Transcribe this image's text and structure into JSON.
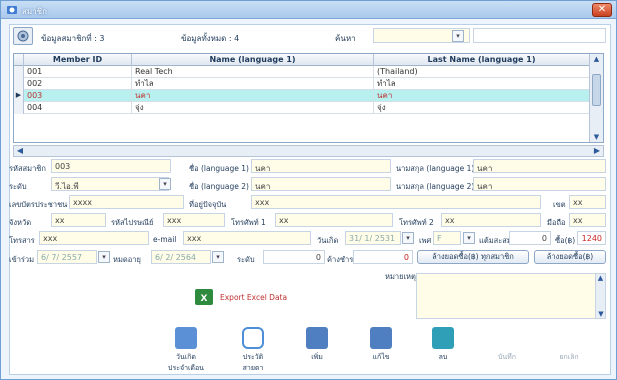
{
  "window": {
    "title": "สมาชิก",
    "close_label": "✕"
  },
  "summary": {
    "members_label": "ข้อมูลสมาชิกที่ : 3",
    "total_label": "ข้อมูลทั้งหมด : 4",
    "search_label": "ค้นหา",
    "search_value": ""
  },
  "grid": {
    "columns": [
      "Member ID",
      "Name (language 1)",
      "Last Name (language 1)"
    ],
    "rows": [
      {
        "id": "001",
        "name": "Real Tech",
        "last": "(Thailand)"
      },
      {
        "id": "002",
        "name": "ทำไล",
        "last": "ทำไล"
      },
      {
        "id": "003",
        "name": "นคา",
        "last": "นคา"
      },
      {
        "id": "004",
        "name": "จุ่ง",
        "last": "จุ่ง"
      }
    ],
    "selected_index": 2
  },
  "form": {
    "member_code_label": "รหัสสมาชิก",
    "member_code": "003",
    "name1_label": "ชื่อ (language 1)",
    "name1": "นคา",
    "lastname1_label": "นามสกุล (language 1)",
    "lastname1": "นคา",
    "level_label": "ระดับ",
    "level": "วี.ไอ.พี",
    "name2_label": "ชื่อ (language 2)",
    "name2": "นคา",
    "lastname2_label": "นามสกุล (language 2)",
    "lastname2": "นคา",
    "idcard_label": "เลขบัตรประชาชน",
    "idcard": "xxxx",
    "address_label": "ที่อยู่ปัจจุบัน",
    "address": "xxx",
    "zip_label": "เขต",
    "zip": "xx",
    "province_label": "จังหวัด",
    "province": "xx",
    "postcode_label": "รหัสไปรษณีย์",
    "postcode": "xxx",
    "phone1_label": "โทรศัพท์ 1",
    "phone1": "xx",
    "phone2_label": "โทรศัพท์ 2",
    "phone2": "xx",
    "mobile_label": "มือถือ",
    "mobile": "xx",
    "fax_label": "โทรสาร",
    "fax": "xxx",
    "email_label": "e-mail",
    "email": "xxx",
    "birthday_label": "วันเกิด",
    "birthday": "31/ 1/ 2531",
    "sex_label": "เพศ",
    "sex": "F",
    "points_label": "แต้มสะสม",
    "points": "0",
    "buy_label": "ซื้อ(฿)",
    "buy": "1240",
    "join_label": "เข้าร่วม",
    "join": "6/ 7/ 2557",
    "expire_label": "หมดอายุ",
    "expire": "6/ 2/ 2564",
    "discount_label": "ระดับ",
    "discount": "0",
    "owed_label": "ค้างชำระ",
    "owed": "0",
    "btn_clear_all": "ล้างยอดซื้อ(฿) ทุกสมาชิก",
    "btn_clear": "ล้างยอดซื้อ(฿)",
    "note_label": "หมายเหตุ",
    "export_label": "Export Excel Data"
  },
  "toolbar": [
    {
      "label": "วันเกิด\nประจำเดือน",
      "icon": "calendar-icon",
      "disabled": false
    },
    {
      "label": "ประวัติสายตา",
      "icon": "glasses-icon",
      "disabled": false
    },
    {
      "label": "เพิ่ม",
      "icon": "add-icon",
      "disabled": false
    },
    {
      "label": "แก้ไข",
      "icon": "edit-icon",
      "disabled": false
    },
    {
      "label": "ลบ",
      "icon": "delete-icon",
      "disabled": false
    },
    {
      "label": "บันทึก",
      "icon": "save-icon",
      "disabled": true
    },
    {
      "label": "ยกเลิก",
      "icon": "cancel-icon",
      "disabled": true
    }
  ],
  "colors": {
    "accent": "#2d6cc0",
    "selection": "#b8f0f0",
    "field": "#fffde8",
    "red_value": "#cc2222"
  }
}
